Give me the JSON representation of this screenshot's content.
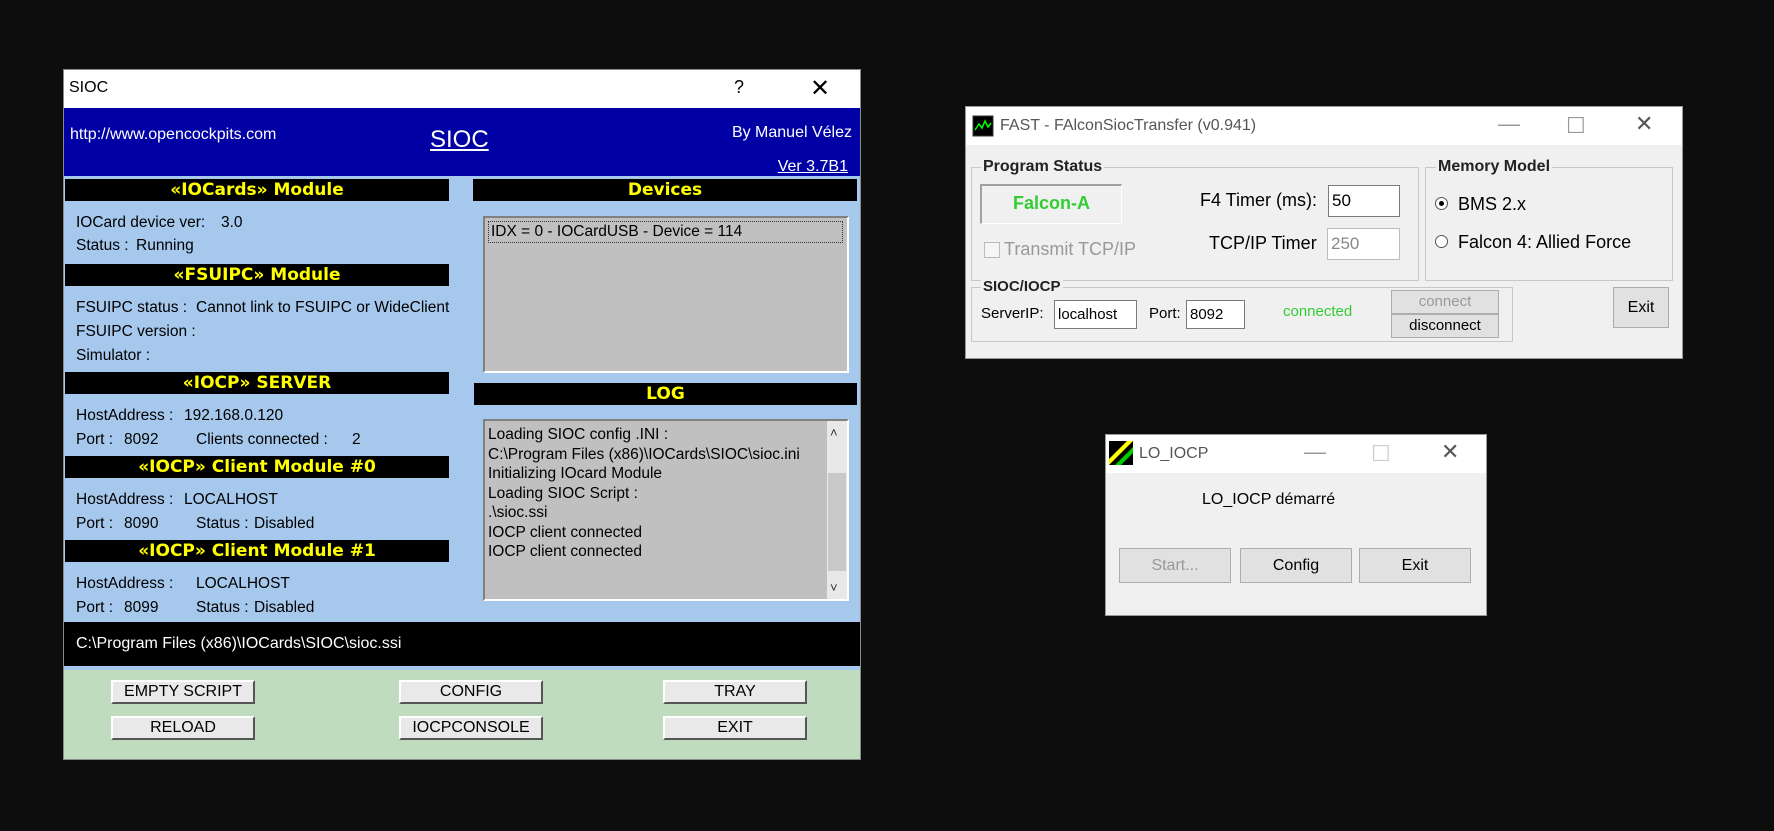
{
  "sioc": {
    "title": "SIOC",
    "help_icon": "?",
    "close_icon": "✕",
    "url": "http://www.opencockpits.com",
    "brand": "SIOC",
    "author": "By Manuel Vélez",
    "version": "Ver 3.7B1",
    "iocards": {
      "header": "«IOCards» Module",
      "device_ver_label": "IOCard device ver:",
      "device_ver": "3.0",
      "status_label": "Status :",
      "status": "Running"
    },
    "fsuipc": {
      "header": "«FSUIPC» Module",
      "status_label": "FSUIPC status :",
      "status": "Cannot link to FSUIPC or WideClient",
      "version_label": "FSUIPC version :",
      "simulator_label": "Simulator :"
    },
    "iocp_server": {
      "header": "«IOCP» SERVER",
      "host_label": "HostAddress :",
      "host": "192.168.0.120",
      "port_label": "Port :",
      "port": "8092",
      "clients_label": "Clients connected :",
      "clients": "2"
    },
    "client0": {
      "header": "«IOCP» Client Module #0",
      "host_label": "HostAddress :",
      "host": "LOCALHOST",
      "port_label": "Port :",
      "port": "8090",
      "status_label": "Status :",
      "status": "Disabled"
    },
    "client1": {
      "header": "«IOCP» Client Module #1",
      "host_label": "HostAddress :",
      "host": "LOCALHOST",
      "port_label": "Port :",
      "port": "8099",
      "status_label": "Status :",
      "status": "Disabled"
    },
    "devices": {
      "header": "Devices",
      "items": [
        "IDX = 0 - IOCardUSB - Device = 114"
      ]
    },
    "log": {
      "header": "LOG",
      "lines": [
        "Loading SIOC config .INI :",
        "C:\\Program Files (x86)\\IOCards\\SIOC\\sioc.ini",
        "Initializing IOcard Module",
        "Loading SIOC Script :",
        ".\\sioc.ssi",
        "IOCP client connected",
        "IOCP client connected"
      ]
    },
    "script_path": "C:\\Program Files (x86)\\IOCards\\SIOC\\sioc.ssi",
    "buttons": {
      "empty_script": "EMPTY SCRIPT",
      "config": "CONFIG",
      "tray": "TRAY",
      "reload": "RELOAD",
      "iocpconsole": "IOCPCONSOLE",
      "exit": "EXIT"
    }
  },
  "fast": {
    "title": "FAST - FAlconSiocTransfer (v0.941)",
    "program_status": {
      "label": "Program Status",
      "value": "Falcon-A",
      "f4_timer_label": "F4 Timer (ms):",
      "f4_timer": "50",
      "tcp_timer_label": "TCP/IP Timer",
      "tcp_timer": "250",
      "transmit_label": "Transmit TCP/IP"
    },
    "memory_model": {
      "label": "Memory Model",
      "options": [
        "BMS 2.x",
        "Falcon 4: Allied Force"
      ],
      "selected": "BMS 2.x"
    },
    "sioc_iocp": {
      "label": "SIOC/IOCP",
      "server_label": "ServerIP:",
      "server": "localhost",
      "port_label": "Port:",
      "port": "8092",
      "status": "connected",
      "connect": "connect",
      "disconnect": "disconnect"
    },
    "exit": "Exit",
    "colors": {
      "status_green": "#33cc33"
    }
  },
  "lo_iocp": {
    "title": "LO_IOCP",
    "message": "LO_IOCP démarré",
    "start": "Start...",
    "config": "Config",
    "exit": "Exit"
  }
}
